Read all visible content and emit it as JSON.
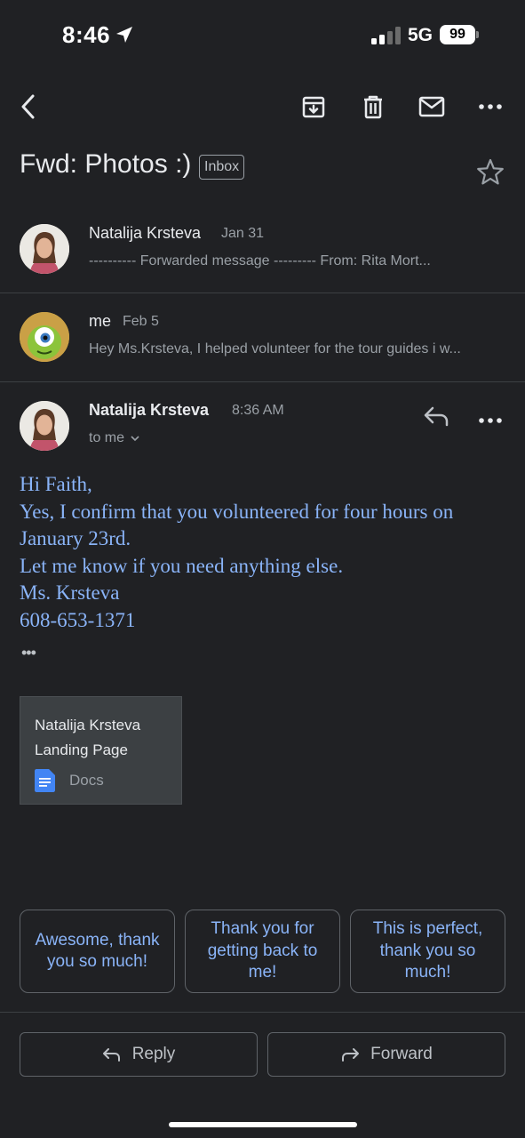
{
  "status": {
    "time": "8:46",
    "network": "5G",
    "battery": "99"
  },
  "toolbar": {
    "icons": [
      "back-icon",
      "archive-icon",
      "delete-icon",
      "mail-icon",
      "more-icon"
    ]
  },
  "subject": {
    "text": "Fwd: Photos :)",
    "label": "Inbox"
  },
  "threads": [
    {
      "sender": "Natalija Krsteva",
      "date": "Jan 31",
      "snippet": "---------- Forwarded message --------- From: Rita Mort..."
    },
    {
      "sender": "me",
      "date": "Feb 5",
      "snippet": "Hey Ms.Krsteva, I helped volunteer for the tour guides i w..."
    }
  ],
  "open_message": {
    "sender": "Natalija Krsteva",
    "time": "8:36 AM",
    "recipient": "to me",
    "body": [
      "Hi Faith,",
      "Yes, I confirm that you volunteered for four hours on",
      "January 23rd.",
      "Let me know if you need anything else.",
      "Ms. Krsteva",
      "608-653-1371"
    ],
    "trimmed": "•••"
  },
  "attachment": {
    "title": "Natalija Krsteva Landing Page",
    "type": "Docs"
  },
  "smart_replies": [
    "Awesome, thank you so much!",
    "Thank you for getting back to me!",
    "This is perfect, thank you so much!"
  ],
  "actions": {
    "reply": "Reply",
    "forward": "Forward"
  },
  "colors": {
    "background": "#202124",
    "accent": "#8ab4f8",
    "divider": "#3c4043"
  }
}
